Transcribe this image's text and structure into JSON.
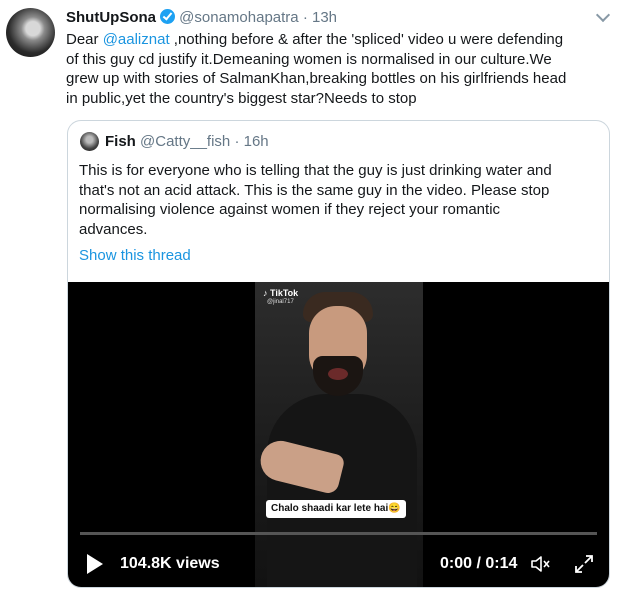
{
  "tweet": {
    "display_name": "ShutUpSona",
    "handle": "@sonamohapatra",
    "time": "· 13h",
    "body_prefix": "Dear ",
    "mention": "@aaliznat",
    "body_rest": " ,nothing before & after the 'spliced' video u were defending\nof this guy cd justify it.Demeaning women is normalised in our culture.We\ngrew up with stories of SalmanKhan,breaking bottles on his girlfriends head\nin public,yet the country's biggest star?Needs to stop"
  },
  "quote": {
    "display_name": "Fish",
    "handle": "@Catty__fish",
    "time": "· 16h",
    "body": "This is for everyone who is telling that the guy is just drinking water and\nthat's not an acid attack. This is the same guy in the video. Please stop\nnormalising violence against women if they reject your romantic\nadvances.",
    "show_thread": "Show this thread"
  },
  "video": {
    "watermark": "TikTok",
    "watermark_user": "@jinal717",
    "caption": "Chalo shaadi kar lete hai😄",
    "views": "104.8K views",
    "time": "0:00 / 0:14",
    "progress": 0
  },
  "icons": {
    "verified": "verified-badge-icon",
    "caret": "chevron-down-icon",
    "play": "play-icon",
    "mute": "volume-muted-icon",
    "fullscreen": "fullscreen-icon"
  },
  "colors": {
    "link": "#1b95e0",
    "verified": "#1da1f2",
    "secondary_text": "#657786"
  }
}
